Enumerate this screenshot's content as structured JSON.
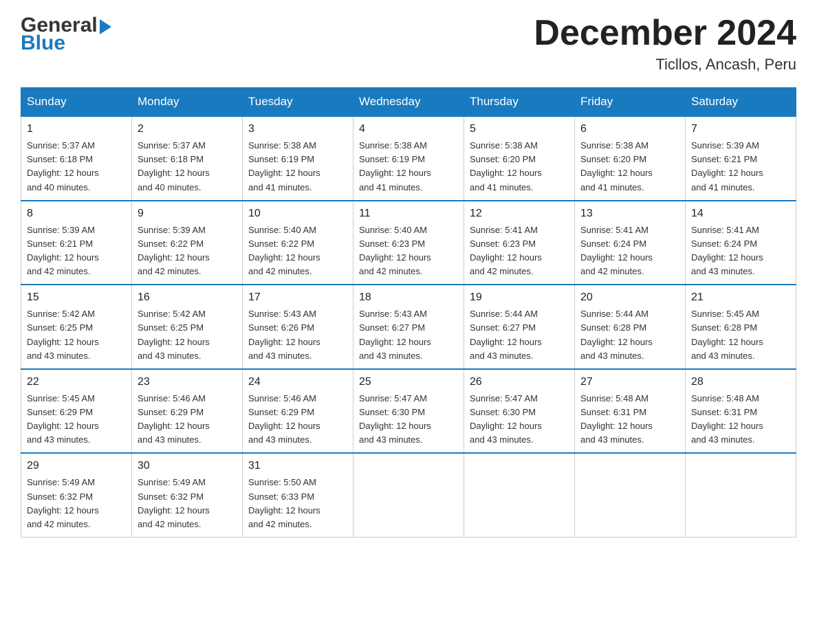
{
  "header": {
    "title": "December 2024",
    "subtitle": "Ticllos, Ancash, Peru",
    "logo_general": "General",
    "logo_blue": "Blue"
  },
  "days_of_week": [
    "Sunday",
    "Monday",
    "Tuesday",
    "Wednesday",
    "Thursday",
    "Friday",
    "Saturday"
  ],
  "weeks": [
    [
      {
        "day": "1",
        "sunrise": "5:37 AM",
        "sunset": "6:18 PM",
        "daylight": "12 hours and 40 minutes."
      },
      {
        "day": "2",
        "sunrise": "5:37 AM",
        "sunset": "6:18 PM",
        "daylight": "12 hours and 40 minutes."
      },
      {
        "day": "3",
        "sunrise": "5:38 AM",
        "sunset": "6:19 PM",
        "daylight": "12 hours and 41 minutes."
      },
      {
        "day": "4",
        "sunrise": "5:38 AM",
        "sunset": "6:19 PM",
        "daylight": "12 hours and 41 minutes."
      },
      {
        "day": "5",
        "sunrise": "5:38 AM",
        "sunset": "6:20 PM",
        "daylight": "12 hours and 41 minutes."
      },
      {
        "day": "6",
        "sunrise": "5:38 AM",
        "sunset": "6:20 PM",
        "daylight": "12 hours and 41 minutes."
      },
      {
        "day": "7",
        "sunrise": "5:39 AM",
        "sunset": "6:21 PM",
        "daylight": "12 hours and 41 minutes."
      }
    ],
    [
      {
        "day": "8",
        "sunrise": "5:39 AM",
        "sunset": "6:21 PM",
        "daylight": "12 hours and 42 minutes."
      },
      {
        "day": "9",
        "sunrise": "5:39 AM",
        "sunset": "6:22 PM",
        "daylight": "12 hours and 42 minutes."
      },
      {
        "day": "10",
        "sunrise": "5:40 AM",
        "sunset": "6:22 PM",
        "daylight": "12 hours and 42 minutes."
      },
      {
        "day": "11",
        "sunrise": "5:40 AM",
        "sunset": "6:23 PM",
        "daylight": "12 hours and 42 minutes."
      },
      {
        "day": "12",
        "sunrise": "5:41 AM",
        "sunset": "6:23 PM",
        "daylight": "12 hours and 42 minutes."
      },
      {
        "day": "13",
        "sunrise": "5:41 AM",
        "sunset": "6:24 PM",
        "daylight": "12 hours and 42 minutes."
      },
      {
        "day": "14",
        "sunrise": "5:41 AM",
        "sunset": "6:24 PM",
        "daylight": "12 hours and 43 minutes."
      }
    ],
    [
      {
        "day": "15",
        "sunrise": "5:42 AM",
        "sunset": "6:25 PM",
        "daylight": "12 hours and 43 minutes."
      },
      {
        "day": "16",
        "sunrise": "5:42 AM",
        "sunset": "6:25 PM",
        "daylight": "12 hours and 43 minutes."
      },
      {
        "day": "17",
        "sunrise": "5:43 AM",
        "sunset": "6:26 PM",
        "daylight": "12 hours and 43 minutes."
      },
      {
        "day": "18",
        "sunrise": "5:43 AM",
        "sunset": "6:27 PM",
        "daylight": "12 hours and 43 minutes."
      },
      {
        "day": "19",
        "sunrise": "5:44 AM",
        "sunset": "6:27 PM",
        "daylight": "12 hours and 43 minutes."
      },
      {
        "day": "20",
        "sunrise": "5:44 AM",
        "sunset": "6:28 PM",
        "daylight": "12 hours and 43 minutes."
      },
      {
        "day": "21",
        "sunrise": "5:45 AM",
        "sunset": "6:28 PM",
        "daylight": "12 hours and 43 minutes."
      }
    ],
    [
      {
        "day": "22",
        "sunrise": "5:45 AM",
        "sunset": "6:29 PM",
        "daylight": "12 hours and 43 minutes."
      },
      {
        "day": "23",
        "sunrise": "5:46 AM",
        "sunset": "6:29 PM",
        "daylight": "12 hours and 43 minutes."
      },
      {
        "day": "24",
        "sunrise": "5:46 AM",
        "sunset": "6:29 PM",
        "daylight": "12 hours and 43 minutes."
      },
      {
        "day": "25",
        "sunrise": "5:47 AM",
        "sunset": "6:30 PM",
        "daylight": "12 hours and 43 minutes."
      },
      {
        "day": "26",
        "sunrise": "5:47 AM",
        "sunset": "6:30 PM",
        "daylight": "12 hours and 43 minutes."
      },
      {
        "day": "27",
        "sunrise": "5:48 AM",
        "sunset": "6:31 PM",
        "daylight": "12 hours and 43 minutes."
      },
      {
        "day": "28",
        "sunrise": "5:48 AM",
        "sunset": "6:31 PM",
        "daylight": "12 hours and 43 minutes."
      }
    ],
    [
      {
        "day": "29",
        "sunrise": "5:49 AM",
        "sunset": "6:32 PM",
        "daylight": "12 hours and 42 minutes."
      },
      {
        "day": "30",
        "sunrise": "5:49 AM",
        "sunset": "6:32 PM",
        "daylight": "12 hours and 42 minutes."
      },
      {
        "day": "31",
        "sunrise": "5:50 AM",
        "sunset": "6:33 PM",
        "daylight": "12 hours and 42 minutes."
      },
      null,
      null,
      null,
      null
    ]
  ],
  "labels": {
    "sunrise": "Sunrise:",
    "sunset": "Sunset:",
    "daylight": "Daylight:"
  }
}
